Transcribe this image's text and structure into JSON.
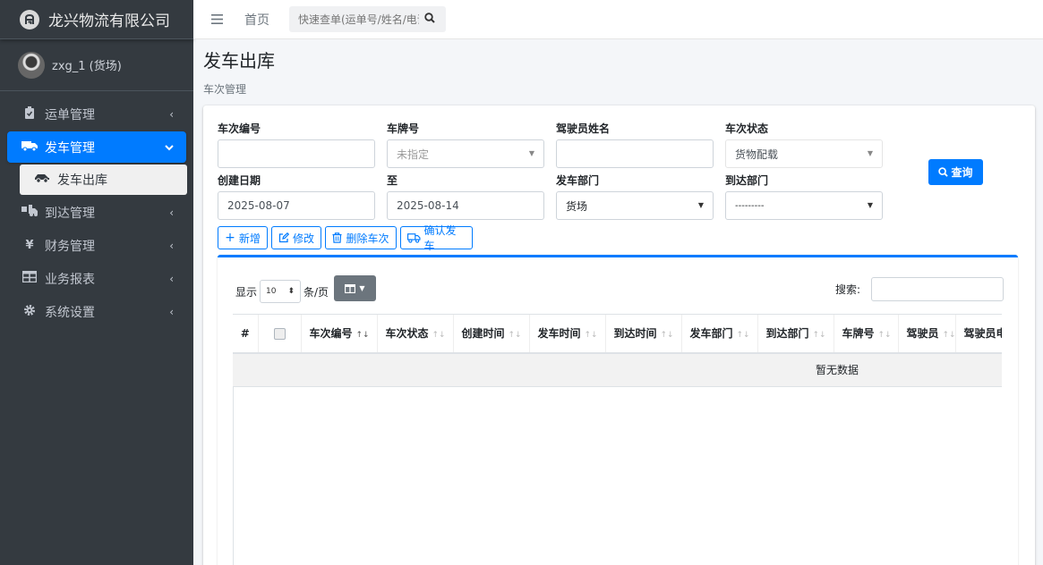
{
  "brand": {
    "logo_letter": "A",
    "name": "龙兴物流有限公司"
  },
  "user": {
    "name": "zxg_1 (货场)"
  },
  "nav": [
    {
      "icon": "clipboard-icon",
      "glyph": "📋",
      "label": "运单管理",
      "chevron": "‹"
    },
    {
      "icon": "truck-icon",
      "glyph": "🚚",
      "label": "发车管理",
      "chevron": "⌄",
      "active": true
    },
    {
      "icon": "truck-loading-icon",
      "glyph": "🚛",
      "label": "到达管理",
      "chevron": "‹"
    },
    {
      "icon": "yen-icon",
      "glyph": "¥",
      "label": "财务管理",
      "chevron": "‹"
    },
    {
      "icon": "table-icon",
      "glyph": "▦",
      "label": "业务报表",
      "chevron": "‹"
    },
    {
      "icon": "gear-icon",
      "glyph": "⚙",
      "label": "系统设置",
      "chevron": "‹"
    }
  ],
  "nav_sub": {
    "icon": "car-side-icon",
    "glyph": "🚙",
    "label": "发车出库"
  },
  "topbar": {
    "home": "首页",
    "quick_search_placeholder": "快速查单(运单号/姓名/电话)"
  },
  "page": {
    "title": "发车出库",
    "breadcrumb": "车次管理"
  },
  "form": {
    "trip_no_label": "车次编号",
    "plate_label": "车牌号",
    "plate_value": "未指定",
    "driver_label": "驾驶员姓名",
    "status_label": "车次状态",
    "status_value": "货物配载",
    "created_label": "创建日期",
    "created_from": "2025-08-07",
    "to_label": "至",
    "created_to": "2025-08-14",
    "dep_dept_label": "发车部门",
    "dep_dept_value": "货场",
    "arr_dept_label": "到达部门",
    "arr_dept_value": "---------",
    "query_button": "查询"
  },
  "toolbar": {
    "add": "新增",
    "edit": "修改",
    "delete": "删除车次",
    "confirm": "确认发车"
  },
  "table": {
    "show_label": "显示",
    "page_size": "10",
    "per_page_label": "条/页",
    "search_label": "搜索:",
    "columns": [
      "#",
      "",
      "车次编号",
      "车次状态",
      "创建时间",
      "发车时间",
      "到达时间",
      "发车部门",
      "到达部门",
      "车牌号",
      "驾驶员",
      "驾驶员电话"
    ],
    "empty_text": "暂无数据"
  },
  "colors": {
    "primary": "#007bff",
    "sidebar": "#343a40",
    "secondary": "#6c757d"
  }
}
